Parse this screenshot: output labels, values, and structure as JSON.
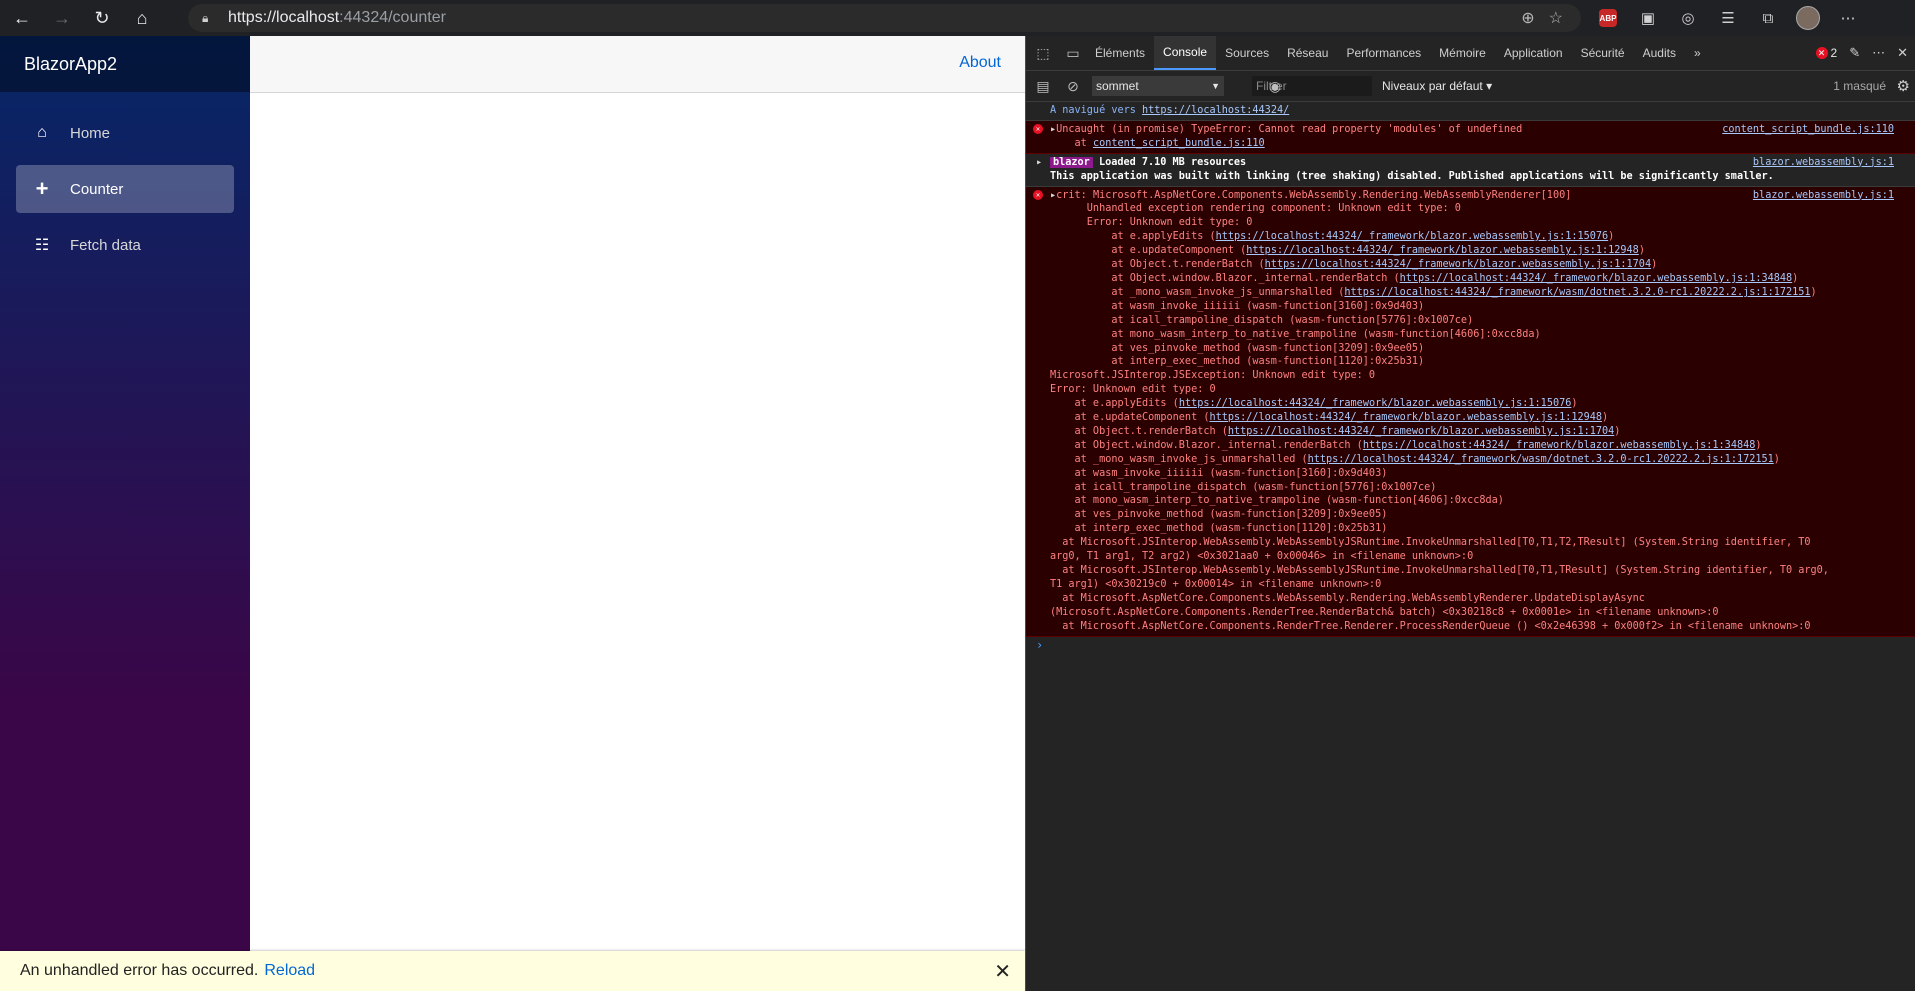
{
  "browser": {
    "url_host": "https://localhost",
    "url_rest": ":44324/counter",
    "ext_abp": "ABP"
  },
  "app": {
    "brand": "BlazorApp2",
    "nav": [
      {
        "label": "Home",
        "icon": "home-icon"
      },
      {
        "label": "Counter",
        "icon": "plus-icon",
        "active": true
      },
      {
        "label": "Fetch data",
        "icon": "list-icon"
      }
    ],
    "about": "About",
    "error_message": "An unhandled error has occurred.",
    "error_reload": "Reload",
    "error_dismiss": "✕"
  },
  "devtools": {
    "tabs": [
      "Éléments",
      "Console",
      "Sources",
      "Réseau",
      "Performances",
      "Mémoire",
      "Application",
      "Sécurité",
      "Audits"
    ],
    "active_tab": "Console",
    "more": "»",
    "error_count": "2",
    "context": "sommet",
    "filter_placeholder": "Filtrer",
    "levels": "Niveaux par défaut ▾",
    "hidden": "1 masqué",
    "console": {
      "nav_prefix": "A navigué vers ",
      "nav_link": "https://localhost:44324/",
      "err1_line1": "Uncaught (in promise) TypeError: Cannot read property 'modules' of undefined",
      "err1_line2_prefix": "    at ",
      "err1_line2_link": "content_script_bundle.js:110",
      "err1_src": "content_script_bundle.js:110",
      "blazor_badge": "blazor",
      "blazor_line1": "Loaded 7.10 MB resources",
      "blazor_line2": "This application was built with linking (tree shaking) disabled. Published applications will be significantly smaller.",
      "blazor_src": "blazor.webassembly.js:1",
      "crit_src": "blazor.webassembly.js:1",
      "crit_lines": [
        "crit: Microsoft.AspNetCore.Components.WebAssembly.Rendering.WebAssemblyRenderer[100]",
        "      Unhandled exception rendering component: Unknown edit type: 0",
        "      Error: Unknown edit type: 0",
        "          at e.applyEdits (https://localhost:44324/_framework/blazor.webassembly.js:1:15076)",
        "          at e.updateComponent (https://localhost:44324/_framework/blazor.webassembly.js:1:12948)",
        "          at Object.t.renderBatch (https://localhost:44324/_framework/blazor.webassembly.js:1:1704)",
        "          at Object.window.Blazor._internal.renderBatch (https://localhost:44324/_framework/blazor.webassembly.js:1:34848)",
        "          at _mono_wasm_invoke_js_unmarshalled (https://localhost:44324/_framework/wasm/dotnet.3.2.0-rc1.20222.2.js:1:172151)",
        "          at wasm_invoke_iiiiii (wasm-function[3160]:0x9d403)",
        "          at icall_trampoline_dispatch (wasm-function[5776]:0x1007ce)",
        "          at mono_wasm_interp_to_native_trampoline (wasm-function[4606]:0xcc8da)",
        "          at ves_pinvoke_method (wasm-function[3209]:0x9ee05)",
        "          at interp_exec_method (wasm-function[1120]:0x25b31)",
        "Microsoft.JSInterop.JSException: Unknown edit type: 0",
        "Error: Unknown edit type: 0",
        "    at e.applyEdits (https://localhost:44324/_framework/blazor.webassembly.js:1:15076)",
        "    at e.updateComponent (https://localhost:44324/_framework/blazor.webassembly.js:1:12948)",
        "    at Object.t.renderBatch (https://localhost:44324/_framework/blazor.webassembly.js:1:1704)",
        "    at Object.window.Blazor._internal.renderBatch (https://localhost:44324/_framework/blazor.webassembly.js:1:34848)",
        "    at _mono_wasm_invoke_js_unmarshalled (https://localhost:44324/_framework/wasm/dotnet.3.2.0-rc1.20222.2.js:1:172151)",
        "    at wasm_invoke_iiiiii (wasm-function[3160]:0x9d403)",
        "    at icall_trampoline_dispatch (wasm-function[5776]:0x1007ce)",
        "    at mono_wasm_interp_to_native_trampoline (wasm-function[4606]:0xcc8da)",
        "    at ves_pinvoke_method (wasm-function[3209]:0x9ee05)",
        "    at interp_exec_method (wasm-function[1120]:0x25b31)",
        "  at Microsoft.JSInterop.WebAssembly.WebAssemblyJSRuntime.InvokeUnmarshalled[T0,T1,T2,TResult] (System.String identifier, T0",
        "arg0, T1 arg1, T2 arg2) <0x3021aa0 + 0x00046> in <filename unknown>:0",
        "  at Microsoft.JSInterop.WebAssembly.WebAssemblyJSRuntime.InvokeUnmarshalled[T0,T1,TResult] (System.String identifier, T0 arg0,",
        "T1 arg1) <0x30219c0 + 0x00014> in <filename unknown>:0",
        "  at Microsoft.AspNetCore.Components.WebAssembly.Rendering.WebAssemblyRenderer.UpdateDisplayAsync",
        "(Microsoft.AspNetCore.Components.RenderTree.RenderBatch& batch) <0x30218c8 + 0x0001e> in <filename unknown>:0",
        "  at Microsoft.AspNetCore.Components.RenderTree.Renderer.ProcessRenderQueue () <0x2e46398 + 0x000f2> in <filename unknown>:0"
      ],
      "prompt": "›"
    }
  }
}
